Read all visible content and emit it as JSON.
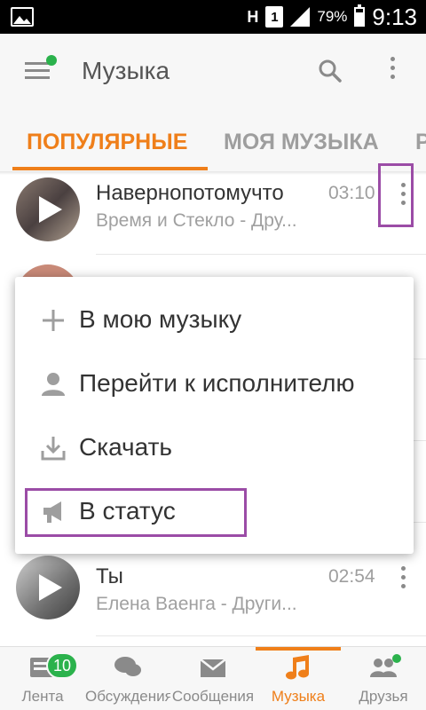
{
  "statusbar": {
    "network": "H",
    "sim": "1",
    "battery": "79%",
    "time": "9:13",
    "icons": [
      "image-icon",
      "signal-icon",
      "battery-icon"
    ]
  },
  "toolbar": {
    "title": "Музыка",
    "icons": [
      "menu-icon",
      "search-icon",
      "more-vertical-icon"
    ]
  },
  "tabs": [
    {
      "label": "ПОПУЛЯРНЫЕ",
      "active": true
    },
    {
      "label": "МОЯ МУЗЫКА",
      "active": false
    },
    {
      "label": "Р",
      "active": false
    }
  ],
  "tracks": [
    {
      "title": "Навернопотомучто",
      "artist": "Время и Стекло - Дру...",
      "duration": "03:10"
    },
    {
      "title": "Ты",
      "artist": "Елена Ваенга - Други...",
      "duration": "02:54"
    }
  ],
  "menu": {
    "items": [
      {
        "label": "В мою музыку",
        "icon": "plus-icon"
      },
      {
        "label": "Перейти к исполнителю",
        "icon": "person-icon"
      },
      {
        "label": "Скачать",
        "icon": "download-icon"
      },
      {
        "label": "В статус",
        "icon": "megaphone-icon"
      }
    ]
  },
  "bottomnav": {
    "items": [
      {
        "label": "Лента",
        "icon": "feed-icon",
        "badge": "10"
      },
      {
        "label": "Обсуждения",
        "icon": "chat-icon"
      },
      {
        "label": "Сообщения",
        "icon": "mail-icon"
      },
      {
        "label": "Музыка",
        "icon": "music-note-icon",
        "active": true
      },
      {
        "label": "Друзья",
        "icon": "friends-icon"
      }
    ]
  },
  "colors": {
    "accent": "#ef7f1a",
    "badge_green": "#2bb24c",
    "highlight": "#9b4ca6"
  }
}
